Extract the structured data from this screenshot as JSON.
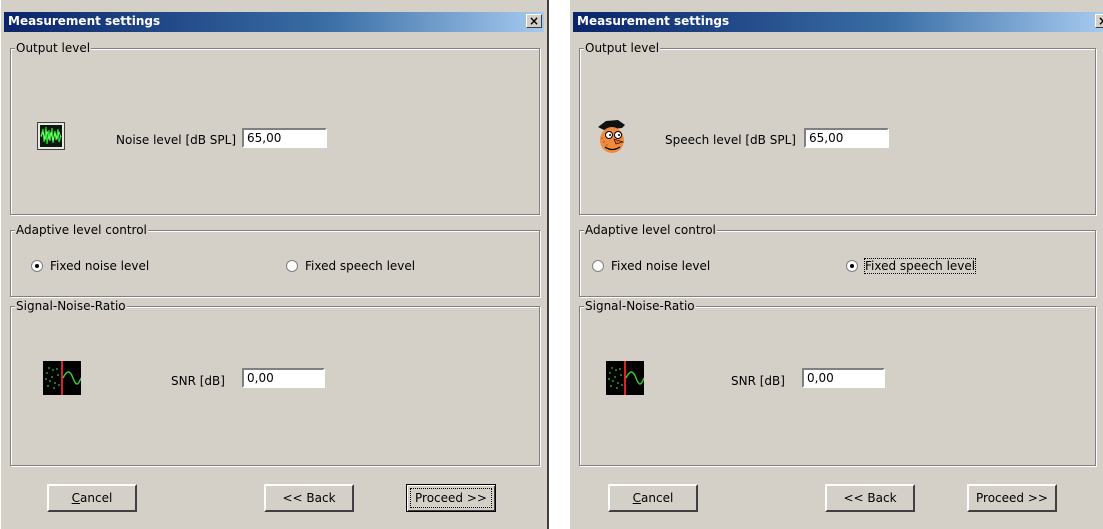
{
  "left": {
    "title": "Measurement settings",
    "close": "×",
    "output_group": "Output level",
    "level_label": "Noise level [dB SPL]",
    "level_value": "65,00",
    "adaptive_group": "Adaptive level control",
    "radio_noise": "Fixed noise level",
    "radio_speech": "Fixed speech level",
    "snr_group": "Signal-Noise-Ratio",
    "snr_label": "SNR [dB]",
    "snr_value": "0,00",
    "cancel_first": "C",
    "cancel_rest": "ancel",
    "back": "<< Back",
    "proceed": "Proceed >>",
    "selected_radio": "noise"
  },
  "right": {
    "title": "Measurement settings",
    "close": "×",
    "output_group": "Output level",
    "level_label": "Speech level [dB SPL]",
    "level_value": "65,00",
    "adaptive_group": "Adaptive level control",
    "radio_noise": "Fixed noise level",
    "radio_speech": "Fixed speech level",
    "snr_group": "Signal-Noise-Ratio",
    "snr_label": "SNR [dB]",
    "snr_value": "0,00",
    "cancel_first": "C",
    "cancel_rest": "ancel",
    "back": "<< Back",
    "proceed": "Proceed >>",
    "selected_radio": "speech"
  },
  "icons": {
    "noise": "noise-waveform-icon",
    "speaker": "speaker-face-icon",
    "snr": "snr-signal-icon"
  }
}
